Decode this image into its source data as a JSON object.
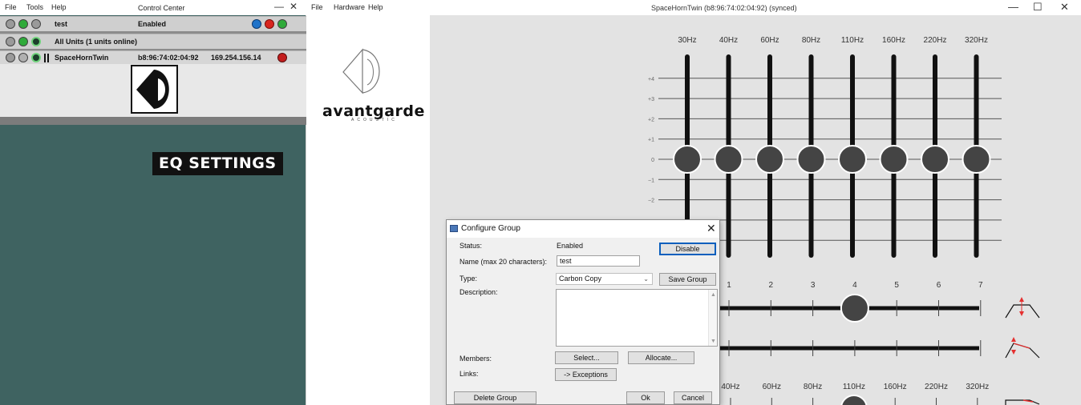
{
  "control_center": {
    "menu": [
      "File",
      "Tools",
      "Help"
    ],
    "title": "Control Center",
    "window_buttons": {
      "minimize": "—",
      "close": "✕"
    },
    "group_row": {
      "name": "test",
      "status": "Enabled"
    },
    "all_units_row": {
      "label": "All Units (1 units online)"
    },
    "device_row": {
      "name": "SpaceHornTwin",
      "mac": "b8:96:74:02:04:92",
      "ip": "169.254.156.14"
    }
  },
  "main_window": {
    "menu": [
      "File",
      "Hardware",
      "Help"
    ],
    "title": "SpaceHornTwin (b8:96:74:02:04:92) (synced)",
    "window_buttons": {
      "minimize": "—",
      "maximize": "☐",
      "close": "✕"
    },
    "brand": {
      "name": "avantgarde",
      "sub": "ACOUSTIC"
    },
    "eq_title": "EQ SETTINGS",
    "eq": {
      "freq_labels": [
        "30Hz",
        "40Hz",
        "60Hz",
        "80Hz",
        "110Hz",
        "160Hz",
        "220Hz",
        "320Hz"
      ],
      "db_labels": [
        "+4",
        "+3",
        "+2",
        "+1",
        "0",
        "−1",
        "−2"
      ],
      "slider_values_db": [
        0,
        0,
        0,
        0,
        0,
        0,
        0,
        0
      ],
      "position_labels": [
        "1",
        "2",
        "3",
        "4",
        "5",
        "6",
        "7"
      ],
      "horizontal_slider_1_value": 4,
      "bottom_freq_labels": [
        "40Hz",
        "60Hz",
        "80Hz",
        "110Hz",
        "160Hz",
        "220Hz",
        "320Hz"
      ],
      "accent_color": "#e53030"
    }
  },
  "dialog": {
    "title": "Configure Group",
    "close": "✕",
    "status_label": "Status:",
    "status_value": "Enabled",
    "disable_button": "Disable",
    "name_label": "Name (max 20 characters):",
    "name_value": "test",
    "type_label": "Type:",
    "type_value": "Carbon Copy",
    "save_group_button": "Save Group",
    "description_label": "Description:",
    "description_value": "",
    "members_label": "Members:",
    "select_button": "Select...",
    "allocate_button": "Allocate...",
    "links_label": "Links:",
    "exceptions_button": "-> Exceptions",
    "delete_group_button": "Delete Group",
    "ok_button": "Ok",
    "cancel_button": "Cancel"
  }
}
